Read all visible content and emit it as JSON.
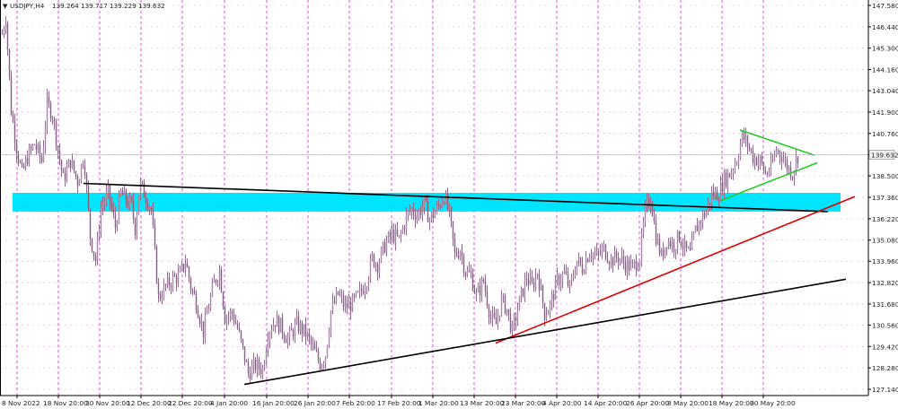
{
  "header": {
    "symbol": "USDJPY,H4",
    "ohlc": "139.264 139.717 139.229 139.632"
  },
  "chart_data": {
    "type": "candlestick",
    "symbol": "USDJPY",
    "timeframe": "H4",
    "ylim": [
      127.0,
      147.7
    ],
    "y_ticks": [
      147.58,
      146.44,
      145.3,
      144.16,
      143.04,
      141.9,
      140.76,
      139.62,
      138.5,
      137.36,
      136.22,
      135.08,
      133.96,
      132.82,
      131.68,
      130.56,
      129.42,
      128.28,
      127.14
    ],
    "y_tick_labels": [
      "147.580",
      "146.440",
      "145.300",
      "144.160",
      "143.040",
      "141.900",
      "140.760",
      "139.632",
      "138.500",
      "137.360",
      "136.220",
      "135.080",
      "133.960",
      "132.820",
      "131.680",
      "130.560",
      "129.420",
      "128.280",
      "127.140"
    ],
    "x_tick_labels": [
      "8 Nov 2022",
      "18 Nov 20:00",
      "30 Nov 20:00",
      "12 Dec 20:00",
      "22 Dec 20:00",
      "4 Jan 20:00",
      "16 Jan 20:00",
      "26 Jan 20:00",
      "7 Feb 20:00",
      "17 Feb 20:00",
      "1 Mar 20:00",
      "13 Mar 20:00",
      "23 Mar 20:00",
      "4 Apr 20:00",
      "14 Apr 20:00",
      "26 Apr 20:00",
      "8 May 20:00",
      "18 May 20:00",
      "30 May 20:00"
    ],
    "current_price": 139.632,
    "price_path": [
      [
        0,
        145.6
      ],
      [
        6,
        147.0
      ],
      [
        12,
        142.0
      ],
      [
        18,
        140.0
      ],
      [
        24,
        138.6
      ],
      [
        30,
        139.5
      ],
      [
        38,
        140.2
      ],
      [
        46,
        139.3
      ],
      [
        52,
        142.3
      ],
      [
        58,
        141.8
      ],
      [
        64,
        139.9
      ],
      [
        70,
        138.3
      ],
      [
        78,
        139.3
      ],
      [
        86,
        138.2
      ],
      [
        93,
        139.6
      ],
      [
        100,
        135.3
      ],
      [
        106,
        134.0
      ],
      [
        112,
        136.8
      ],
      [
        120,
        137.6
      ],
      [
        128,
        135.8
      ],
      [
        134,
        137.6
      ],
      [
        140,
        137.2
      ],
      [
        146,
        136.9
      ],
      [
        150,
        135.7
      ],
      [
        155,
        138.1
      ],
      [
        162,
        137.4
      ],
      [
        168,
        136.7
      ],
      [
        176,
        132.0
      ],
      [
        184,
        132.6
      ],
      [
        192,
        133.0
      ],
      [
        200,
        133.2
      ],
      [
        206,
        134.0
      ],
      [
        212,
        132.6
      ],
      [
        218,
        131.8
      ],
      [
        226,
        130.2
      ],
      [
        232,
        131.6
      ],
      [
        238,
        132.8
      ],
      [
        244,
        133.5
      ],
      [
        250,
        131.0
      ],
      [
        258,
        131.2
      ],
      [
        264,
        130.4
      ],
      [
        270,
        129.2
      ],
      [
        276,
        128.0
      ],
      [
        284,
        128.4
      ],
      [
        292,
        128.2
      ],
      [
        298,
        130.2
      ],
      [
        306,
        130.8
      ],
      [
        312,
        130.5
      ],
      [
        320,
        129.8
      ],
      [
        330,
        130.6
      ],
      [
        340,
        130.1
      ],
      [
        348,
        129.3
      ],
      [
        356,
        128.5
      ],
      [
        362,
        129.0
      ],
      [
        368,
        131.3
      ],
      [
        376,
        132.2
      ],
      [
        384,
        131.5
      ],
      [
        392,
        131.7
      ],
      [
        400,
        132.2
      ],
      [
        408,
        133.0
      ],
      [
        414,
        134.1
      ],
      [
        420,
        133.8
      ],
      [
        428,
        134.8
      ],
      [
        436,
        135.4
      ],
      [
        444,
        135.1
      ],
      [
        452,
        136.3
      ],
      [
        458,
        136.7
      ],
      [
        464,
        136.4
      ],
      [
        472,
        137.0
      ],
      [
        478,
        136.2
      ],
      [
        486,
        136.7
      ],
      [
        494,
        137.5
      ],
      [
        500,
        136.4
      ],
      [
        506,
        134.3
      ],
      [
        512,
        134.6
      ],
      [
        518,
        133.4
      ],
      [
        524,
        133.2
      ],
      [
        530,
        132.1
      ],
      [
        538,
        132.9
      ],
      [
        546,
        130.9
      ],
      [
        552,
        130.6
      ],
      [
        558,
        131.9
      ],
      [
        564,
        131.4
      ],
      [
        570,
        130.2
      ],
      [
        578,
        131.8
      ],
      [
        586,
        133.1
      ],
      [
        592,
        132.6
      ],
      [
        598,
        133.4
      ],
      [
        606,
        131.2
      ],
      [
        612,
        131.6
      ],
      [
        620,
        132.9
      ],
      [
        628,
        133.3
      ],
      [
        634,
        132.5
      ],
      [
        642,
        134.0
      ],
      [
        648,
        133.6
      ],
      [
        656,
        134.5
      ],
      [
        664,
        134.2
      ],
      [
        672,
        134.6
      ],
      [
        680,
        134.0
      ],
      [
        688,
        134.2
      ],
      [
        696,
        133.8
      ],
      [
        704,
        133.6
      ],
      [
        712,
        134.2
      ],
      [
        718,
        136.6
      ],
      [
        724,
        137.4
      ],
      [
        730,
        135.3
      ],
      [
        736,
        134.2
      ],
      [
        742,
        135.1
      ],
      [
        750,
        134.8
      ],
      [
        756,
        135.3
      ],
      [
        762,
        134.6
      ],
      [
        768,
        134.3
      ],
      [
        774,
        135.6
      ],
      [
        780,
        136.2
      ],
      [
        786,
        136.6
      ],
      [
        792,
        137.5
      ],
      [
        800,
        137.6
      ],
      [
        806,
        138.3
      ],
      [
        812,
        138.6
      ],
      [
        820,
        139.4
      ],
      [
        826,
        140.6
      ],
      [
        832,
        140.2
      ],
      [
        838,
        139.5
      ],
      [
        846,
        139.3
      ],
      [
        852,
        138.6
      ],
      [
        858,
        138.9
      ],
      [
        864,
        139.9
      ],
      [
        870,
        139.6
      ],
      [
        876,
        139.0
      ],
      [
        882,
        138.7
      ],
      [
        888,
        139.6
      ]
    ],
    "overlays": [
      {
        "kind": "zone",
        "color": "#00e5ff",
        "price_top": 137.6,
        "price_bottom": 136.6
      },
      {
        "kind": "trendline",
        "color": "#000000",
        "from": [
          93,
          138.1
        ],
        "to": [
          922,
          136.6
        ]
      },
      {
        "kind": "trendline",
        "color": "#e00000",
        "from": [
          552,
          129.6
        ],
        "to": [
          952,
          137.4
        ]
      },
      {
        "kind": "trendline",
        "color": "#000000",
        "from": [
          272,
          127.4
        ],
        "to": [
          942,
          133.0
        ]
      },
      {
        "kind": "trendline",
        "color": "#22cc22",
        "from": [
          824,
          140.95
        ],
        "to": [
          907,
          139.6
        ]
      },
      {
        "kind": "trendline",
        "color": "#22cc22",
        "from": [
          803,
          137.2
        ],
        "to": [
          910,
          139.2
        ]
      }
    ]
  }
}
